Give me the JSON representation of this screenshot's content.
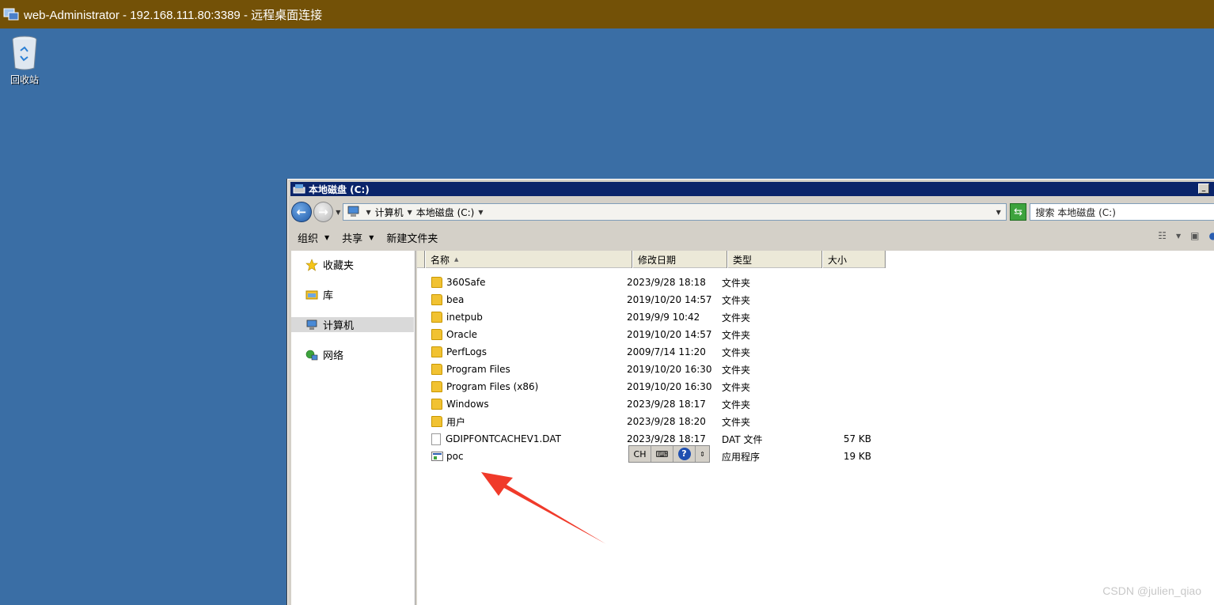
{
  "rdp": {
    "title": "web-Administrator - 192.168.111.80:3389 - 远程桌面连接"
  },
  "desktop": {
    "recycle_bin_label": "回收站"
  },
  "window": {
    "title": "本地磁盘 (C:)",
    "address": {
      "crumbs": [
        "计算机",
        "本地磁盘 (C:)"
      ]
    },
    "search_placeholder": "搜索 本地磁盘 (C:)",
    "toolbar": {
      "organize": "组织",
      "share": "共享",
      "new_folder": "新建文件夹"
    },
    "nav": {
      "favorites": "收藏夹",
      "libraries": "库",
      "computer": "计算机",
      "network": "网络"
    },
    "columns": {
      "name": "名称",
      "date": "修改日期",
      "type": "类型",
      "size": "大小"
    },
    "files": [
      {
        "name": "360Safe",
        "date": "2023/9/28 18:18",
        "type": "文件夹",
        "size": "",
        "kind": "folder"
      },
      {
        "name": "bea",
        "date": "2019/10/20 14:57",
        "type": "文件夹",
        "size": "",
        "kind": "folder"
      },
      {
        "name": "inetpub",
        "date": "2019/9/9 10:42",
        "type": "文件夹",
        "size": "",
        "kind": "folder"
      },
      {
        "name": "Oracle",
        "date": "2019/10/20 14:57",
        "type": "文件夹",
        "size": "",
        "kind": "folder"
      },
      {
        "name": "PerfLogs",
        "date": "2009/7/14 11:20",
        "type": "文件夹",
        "size": "",
        "kind": "folder"
      },
      {
        "name": "Program Files",
        "date": "2019/10/20 16:30",
        "type": "文件夹",
        "size": "",
        "kind": "folder"
      },
      {
        "name": "Program Files (x86)",
        "date": "2019/10/20 16:30",
        "type": "文件夹",
        "size": "",
        "kind": "folder"
      },
      {
        "name": "Windows",
        "date": "2023/9/28 18:17",
        "type": "文件夹",
        "size": "",
        "kind": "folder"
      },
      {
        "name": "用户",
        "date": "2023/9/28 18:20",
        "type": "文件夹",
        "size": "",
        "kind": "folder"
      },
      {
        "name": "GDIPFONTCACHEV1.DAT",
        "date": "2023/9/28 18:17",
        "type": "DAT 文件",
        "size": "57 KB",
        "kind": "file"
      },
      {
        "name": "poc",
        "date": "",
        "type": "应用程序",
        "size": "19 KB",
        "kind": "exe"
      }
    ]
  },
  "ime": {
    "lang": "CH"
  },
  "watermark": "CSDN @julien_qiao",
  "colors": {
    "desktop": "#3a6ea5",
    "rdp_bar": "#735107",
    "title_bar": "#0a246a",
    "annotation_arrow": "#f03a2a"
  }
}
